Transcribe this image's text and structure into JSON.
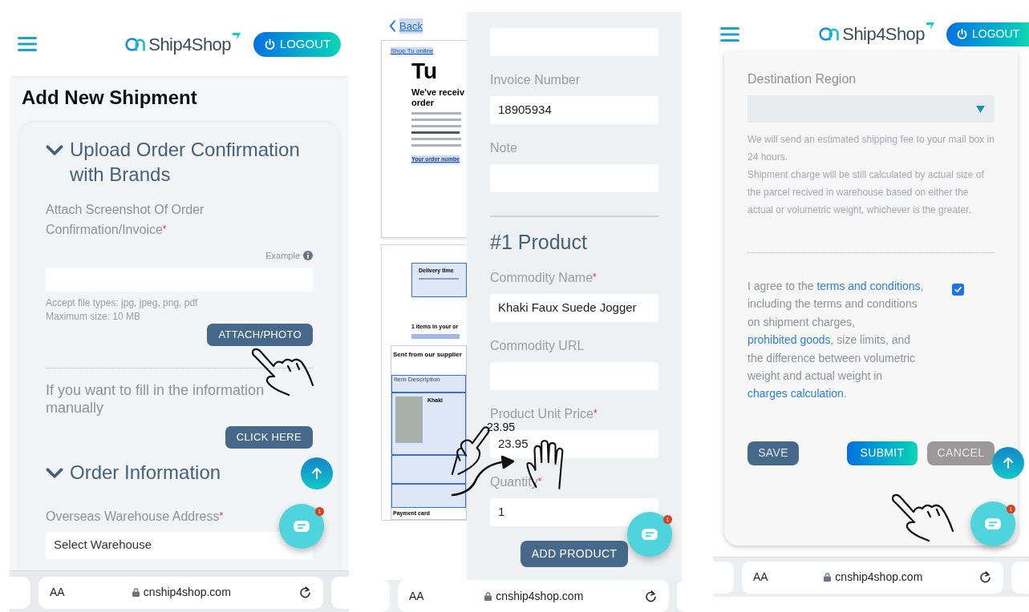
{
  "screen_1": {
    "header": {
      "brand": "Ship4Shop",
      "logout": "LOGOUT"
    },
    "page_title": "Add New Shipment",
    "upload_section": {
      "title": "Upload Order Confirmation with Brands",
      "expanded": true,
      "label": "Attach Screenshot Of Order Confirmation/Invoice",
      "required_mark": "*",
      "example": "Example",
      "hints": [
        "Accept file types: jpg, jpeg, png, pdf",
        "Maximum size: 10 MB"
      ],
      "attach_button": "ATTACH/PHOTO",
      "manual_text": "If you want to fill in the information manually",
      "click_here_button": "CLICK HERE"
    },
    "order_section": {
      "title": "Order Information",
      "expanded": true,
      "label": "Overseas Warehouse Address",
      "required_mark": "*",
      "value": "Select Warehouse"
    },
    "chat_badge": "1",
    "address_bar": {
      "text_size": "AA",
      "url": "cnship4shop.com"
    }
  },
  "screen_2": {
    "document": {
      "back": "Back",
      "shop_link": "Shop Tu online",
      "logo": "Tu",
      "heading": "We've receiv order",
      "order_number": "Your order numbe",
      "delivery": "Delivery time",
      "items": "1 items in your or",
      "supplier": "Sent from our supplier",
      "item_description": "Item Description",
      "product": "Khaki",
      "payment": "Payment card"
    },
    "fields": [
      {
        "kind": "text"
      },
      {
        "kind": "text",
        "label": "Invoice Number",
        "value": "18905934"
      },
      {
        "kind": "text",
        "label": "Note"
      }
    ],
    "product_title": "#1 Product",
    "product_fields": [
      {
        "label": "Commodity Name",
        "required_mark": "*",
        "value": "Khaki Faux Suede Jogger"
      },
      {
        "label": "Commodity URL"
      },
      {
        "label": "Product Unit Price",
        "required_mark": "*",
        "value": "23.95"
      },
      {
        "label": "Quantity",
        "required_mark": "*",
        "value": "1"
      }
    ],
    "gesture_value": "23.95",
    "add_button": "ADD PRODUCT",
    "chat_badge": "1",
    "address_bar": {
      "text_size": "AA",
      "url": "cnship4shop.com"
    }
  },
  "screen_3": {
    "header": {
      "brand": "Ship4Shop",
      "logout": "LOGOUT"
    },
    "destination_label": "Destination Region",
    "notes": [
      "We will send an estimated shipping fee to your mail box in 24 hours.",
      "Shipment charge will be still calculated by actual size of the parcel recived in warehouse based on either the actual or volumetric weight, whichever is the greater."
    ],
    "agreement": [
      {
        "text": "I agree to the ",
        "link": false
      },
      {
        "text": "terms and conditions",
        "link": true
      },
      {
        "text": ", including the terms and conditions on shipment charges, ",
        "link": false
      },
      {
        "text": "prohibited goods",
        "link": true
      },
      {
        "text": ", size limits, and the difference between volumetric weight and actual weight in ",
        "link": false
      },
      {
        "text": "charges calculation",
        "link": true
      },
      {
        "text": ".",
        "link": false
      }
    ],
    "agreement_checked": true,
    "buttons": [
      {
        "kind": "save",
        "label": "SAVE"
      },
      {
        "kind": "submit",
        "label": "SUBMIT"
      },
      {
        "kind": "cancel",
        "label": "CANCEL"
      }
    ],
    "chat_badge": "1",
    "address_bar": {
      "text_size": "AA",
      "url": "cnship4shop.com"
    }
  }
}
